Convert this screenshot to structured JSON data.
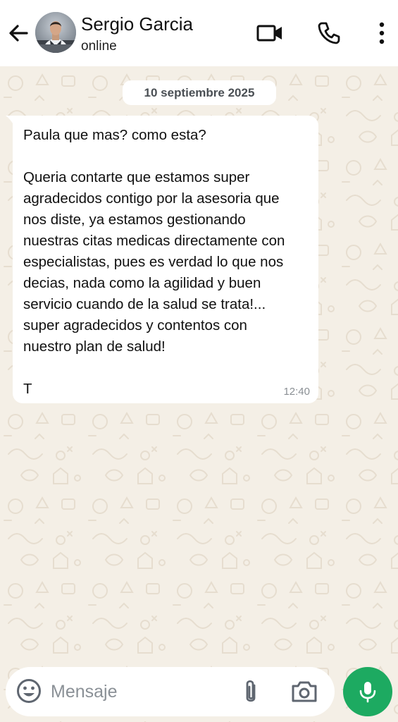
{
  "header": {
    "back_icon": "arrow-left-icon",
    "contact_name": "Sergio Garcia",
    "contact_status": "online",
    "video_icon": "video-call-icon",
    "call_icon": "phone-icon",
    "menu_icon": "more-vertical-icon"
  },
  "chat": {
    "date_separator": "10 septiembre 2025",
    "messages": [
      {
        "direction": "incoming",
        "lines": [
          "Paula que mas? como esta?",
          "",
          "Queria contarte que estamos super",
          "agradecidos contigo por la asesoria que",
          "nos diste, ya estamos gestionando",
          "nuestras citas medicas directamente con",
          "especialistas, pues es verdad lo que nos",
          "decias, nada como la agilidad y buen",
          "servicio cuando de la salud se trata!...",
          "super agradecidos y contentos con",
          "nuestro plan de salud!",
          "",
          "T"
        ],
        "time": "12:40"
      }
    ]
  },
  "composer": {
    "emoji_icon": "emoji-icon",
    "placeholder": "Mensaje",
    "value": "",
    "attach_icon": "paperclip-icon",
    "camera_icon": "camera-icon",
    "mic_icon": "microphone-icon"
  },
  "colors": {
    "wallpaper": "#f4efe6",
    "header_bg": "#ffffff",
    "bubble_incoming": "#ffffff",
    "accent_green": "#1daa61",
    "timestamp": "#8a8f94"
  }
}
